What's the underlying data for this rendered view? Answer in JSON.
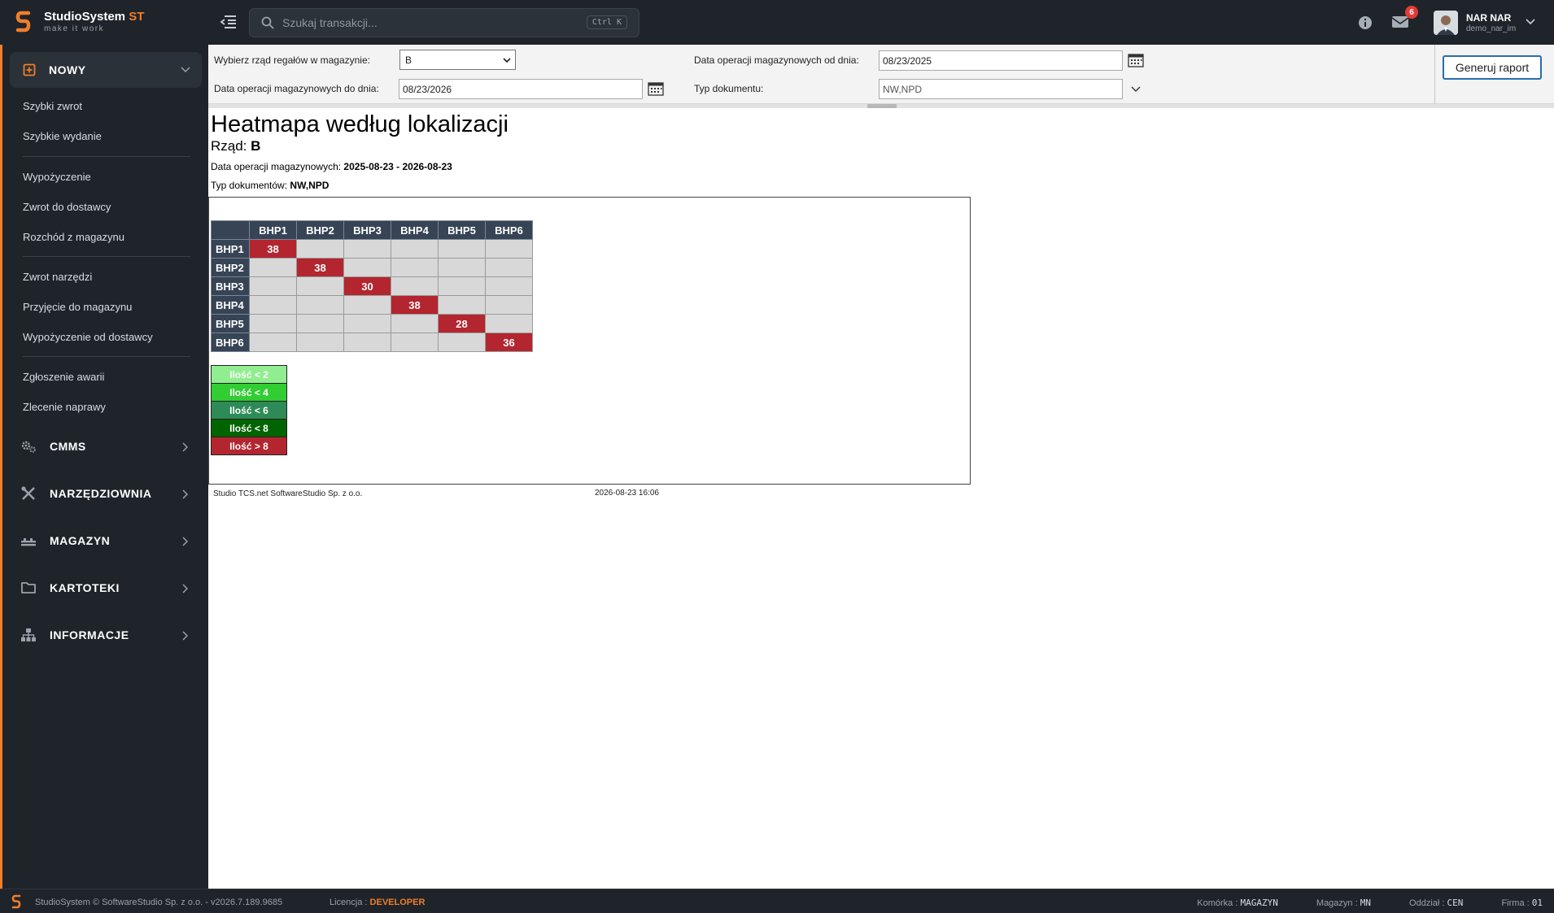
{
  "app": {
    "brand": "StudioSystem",
    "brand_accent": "ST",
    "tagline": "make it work",
    "search_placeholder": "Szukaj transakcji...",
    "search_shortcut": "Ctrl K",
    "notification_count": "6",
    "user_name": "NAR NAR",
    "user_login": "demo_nar_im",
    "accent_color": "#f07f2a"
  },
  "sidebar": {
    "expanded_section": "NOWY",
    "items": [
      "Szybki zwrot",
      "Szybkie wydanie",
      "Wypożyczenie",
      "Zwrot do dostawcy",
      "Rozchód z magazynu",
      "Zwrot narzędzi",
      "Przyjęcie do magazynu",
      "Wypożyczenie od dostawcy",
      "Zgłoszenie awarii",
      "Zlecenie naprawy"
    ],
    "sections": [
      {
        "label": "CMMS",
        "icon": "gears-icon"
      },
      {
        "label": "NARZĘDZIOWNIA",
        "icon": "tools-icon"
      },
      {
        "label": "MAGAZYN",
        "icon": "warehouse-icon"
      },
      {
        "label": "KARTOTEKI",
        "icon": "folder-icon"
      },
      {
        "label": "INFORMACJE",
        "icon": "sitemap-icon"
      }
    ]
  },
  "params": {
    "row_label": "Wybierz rząd regałów w magazynie:",
    "row_value": "B",
    "date_from_label": "Data operacji magazynowych od dnia:",
    "date_from_value": "08/23/2025",
    "date_to_label": "Data operacji magazynowych do dnia:",
    "date_to_value": "08/23/2026",
    "doc_type_label": "Typ dokumentu:",
    "doc_type_value": "NW,NPD",
    "generate_label": "Generuj raport"
  },
  "report": {
    "title": "Heatmapa według lokalizacji",
    "row_prefix": "Rząd:",
    "row_value": "B",
    "dates_prefix": "Data operacji magazynowych:",
    "dates_value": "2025-08-23 - 2026-08-23",
    "doc_prefix": "Typ dokumentów:",
    "doc_value": "NW,NPD",
    "footer_company": "Studio TCS.net SoftwareStudio Sp. z o.o.",
    "footer_timestamp": "2026-08-23 16:06"
  },
  "chart_data": {
    "type": "heatmap",
    "columns": [
      "BHP1",
      "BHP2",
      "BHP3",
      "BHP4",
      "BHP5",
      "BHP6"
    ],
    "rows": [
      "BHP1",
      "BHP2",
      "BHP3",
      "BHP4",
      "BHP5",
      "BHP6"
    ],
    "values": [
      [
        38,
        null,
        null,
        null,
        null,
        null
      ],
      [
        null,
        38,
        null,
        null,
        null,
        null
      ],
      [
        null,
        null,
        30,
        null,
        null,
        null
      ],
      [
        null,
        null,
        null,
        38,
        null,
        null
      ],
      [
        null,
        null,
        null,
        null,
        28,
        null
      ],
      [
        null,
        null,
        null,
        null,
        null,
        36
      ]
    ],
    "legend": [
      {
        "label": "Ilość < 2",
        "color": "#90ee90"
      },
      {
        "label": "Ilość < 4",
        "color": "#32cd32"
      },
      {
        "label": "Ilość < 6",
        "color": "#2e8b57"
      },
      {
        "label": "Ilość < 8",
        "color": "#006400"
      },
      {
        "label": "Ilość > 8",
        "color": "#b3262f"
      }
    ]
  },
  "statusbar": {
    "copyright": "StudioSystem © SoftwareStudio Sp. z o.o. - v2026.7.189.9685",
    "license_label": "Licencja :",
    "license_value": "DEVELOPER",
    "cell_label": "Komórka :",
    "cell_value": "MAGAZYN",
    "warehouse_label": "Magazyn :",
    "warehouse_value": "MN",
    "branch_label": "Oddział :",
    "branch_value": "CEN",
    "company_label": "Firma :",
    "company_value": "01"
  }
}
